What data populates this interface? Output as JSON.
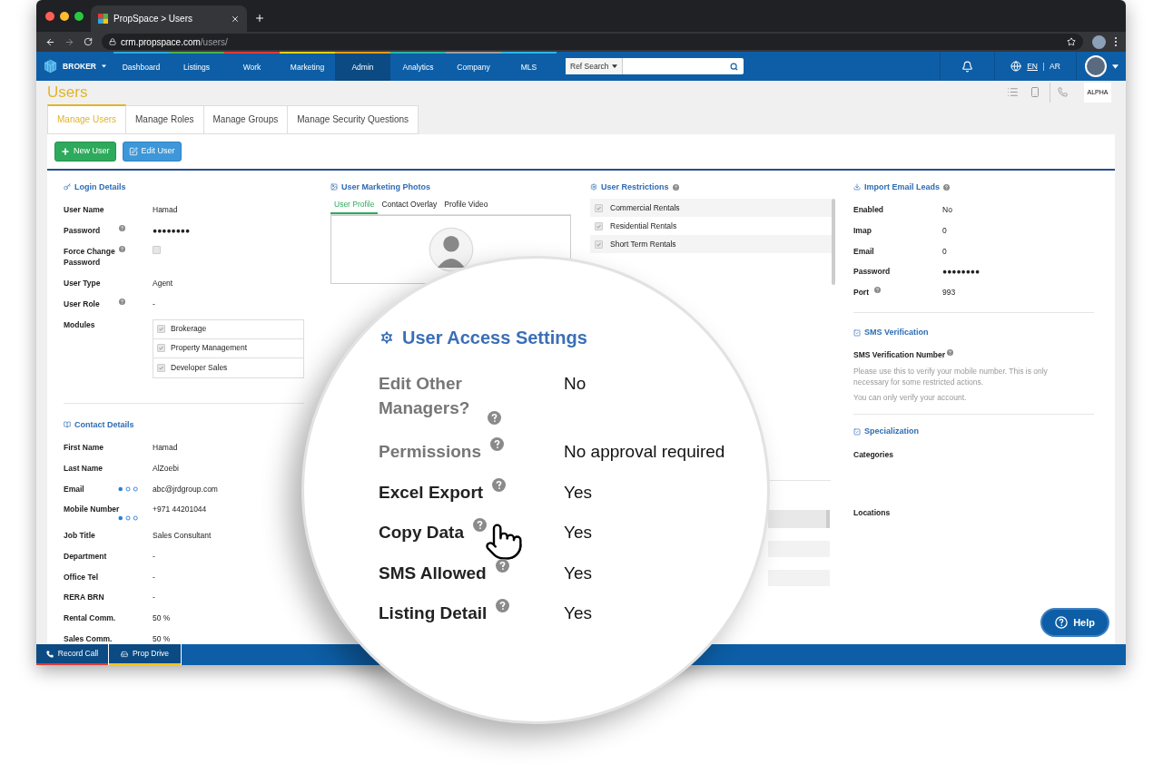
{
  "browser": {
    "tab_title": "PropSpace > Users",
    "url_host": "crm.propspace.com",
    "url_path": "/users/"
  },
  "nav": {
    "role": "BROKER",
    "items": [
      {
        "label": "Dashboard",
        "color": "#29abe2",
        "selected": false
      },
      {
        "label": "Listings",
        "color": "#4caf50",
        "selected": false
      },
      {
        "label": "Work",
        "color": "#e53935",
        "selected": false
      },
      {
        "label": "Marketing",
        "color": "#f5d000",
        "selected": false
      },
      {
        "label": "Admin",
        "color": "#f39c12",
        "selected": true
      },
      {
        "label": "Analytics",
        "color": "#26b8a5",
        "selected": false
      },
      {
        "label": "Company",
        "color": "#9e9e9e",
        "selected": false
      },
      {
        "label": "MLS",
        "color": "#29b6f6",
        "selected": false
      }
    ],
    "search_dropdown": "Ref Search",
    "languages": [
      {
        "label": "EN",
        "selected": true
      },
      {
        "label": "AR",
        "selected": false
      }
    ]
  },
  "page": {
    "title": "Users",
    "logo_text": "ALPHA"
  },
  "tabs": [
    {
      "label": "Manage Users",
      "selected": true
    },
    {
      "label": "Manage Roles",
      "selected": false
    },
    {
      "label": "Manage Groups",
      "selected": false
    },
    {
      "label": "Manage Security Questions",
      "selected": false
    }
  ],
  "buttons": [
    {
      "label": "New User",
      "kind": "new"
    },
    {
      "label": "Edit User",
      "kind": "edit"
    }
  ],
  "login_details": {
    "title": "Login Details",
    "rows": [
      {
        "label": "User Name",
        "kind": "text",
        "value": "Hamad",
        "help": false
      },
      {
        "label": "Password",
        "kind": "text",
        "value": "●●●●●●●●",
        "help": true
      },
      {
        "label": "Force Change Password",
        "kind": "checkbox",
        "checked": false,
        "help": true
      },
      {
        "label": "User Type",
        "kind": "text",
        "value": "Agent",
        "help": false
      },
      {
        "label": "User Role",
        "kind": "text",
        "value": "-",
        "help": true
      },
      {
        "label": "Modules",
        "kind": "modules",
        "help": false,
        "modules": [
          {
            "label": "Brokerage",
            "checked": true
          },
          {
            "label": "Property Management",
            "checked": true
          },
          {
            "label": "Developer Sales",
            "checked": true
          }
        ]
      }
    ]
  },
  "contact_details": {
    "title": "Contact Details",
    "rows": [
      {
        "label": "First Name",
        "value": "Hamad",
        "dots": false
      },
      {
        "label": "Last Name",
        "value": "AlZoebi",
        "dots": false
      },
      {
        "label": "Email",
        "value": "abc@jrdgroup.com",
        "dots": true
      },
      {
        "label": "Mobile Number",
        "value": "+971 44201044",
        "dots": true
      },
      {
        "label": "Job Title",
        "value": "Sales Consultant",
        "dots": false
      },
      {
        "label": "Department",
        "value": "-",
        "dots": false
      },
      {
        "label": "Office Tel",
        "value": "-",
        "dots": false
      },
      {
        "label": "RERA BRN",
        "value": "-",
        "dots": false
      },
      {
        "label": "Rental Comm.",
        "value": "50 %",
        "dots": false
      },
      {
        "label": "Sales Comm.",
        "value": "50 %",
        "dots": false
      }
    ]
  },
  "marketing_photos": {
    "title": "User Marketing Photos",
    "tabs": [
      {
        "label": "User Profile",
        "selected": true
      },
      {
        "label": "Contact Overlay",
        "selected": false
      },
      {
        "label": "Profile Video",
        "selected": false
      }
    ]
  },
  "restrictions": {
    "title": "User Restrictions",
    "items": [
      {
        "label": "Commercial Rentals",
        "checked": true
      },
      {
        "label": "Residential Rentals",
        "checked": true
      },
      {
        "label": "Short Term Rentals",
        "checked": true
      }
    ]
  },
  "import_email_leads": {
    "title": "Import Email Leads",
    "rows": [
      {
        "label": "Enabled",
        "value": "No",
        "help": false
      },
      {
        "label": "Imap",
        "value": "0",
        "help": false
      },
      {
        "label": "Email",
        "value": "0",
        "help": false
      },
      {
        "label": "Password",
        "value": "●●●●●●●●",
        "help": false
      },
      {
        "label": "Port",
        "value": "993",
        "help": true
      }
    ]
  },
  "sms_verification": {
    "title": "SMS Verification",
    "field_label": "SMS Verification Number",
    "notes": [
      "Please use this to verify your mobile number. This is only necessary for some restricted actions.",
      "You can only verify your account."
    ]
  },
  "specialization": {
    "title": "Specialization",
    "fields": [
      "Categories",
      "Locations"
    ]
  },
  "magnifier": {
    "title": "User Access Settings",
    "rows": [
      {
        "label": "Edit Other Managers?",
        "value": "No",
        "muted": true
      },
      {
        "label": "Permissions",
        "value": "No approval required",
        "muted": true
      },
      {
        "label": "Excel Export",
        "value": "Yes",
        "muted": false
      },
      {
        "label": "Copy Data",
        "value": "Yes",
        "muted": false
      },
      {
        "label": "SMS Allowed",
        "value": "Yes",
        "muted": false
      },
      {
        "label": "Listing Detail",
        "value": "Yes",
        "muted": false
      }
    ]
  },
  "help_button": "Help",
  "bottom_bar": [
    {
      "label": "Record Call",
      "kind": "phone",
      "color": "#e53935"
    },
    {
      "label": "Prop Drive",
      "kind": "drive",
      "color": "#f5c518"
    }
  ]
}
